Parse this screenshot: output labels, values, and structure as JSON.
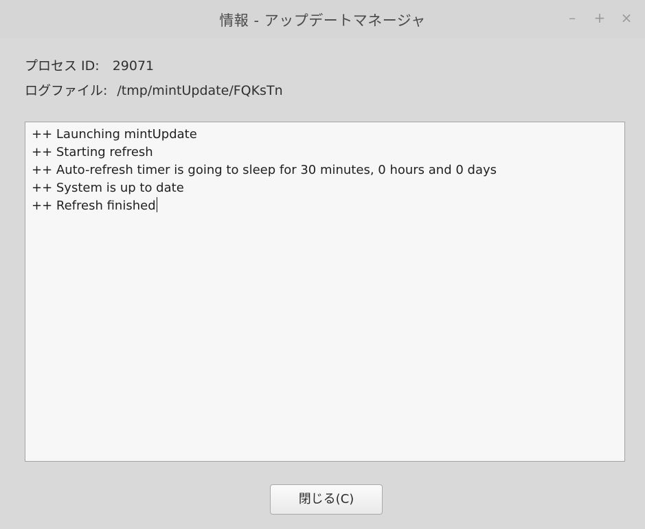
{
  "window": {
    "title": "情報 - アップデートマネージャ",
    "controls": {
      "minimize": "–",
      "maximize": "+",
      "close": "×"
    }
  },
  "info": {
    "process_id_label": "プロセス ID:",
    "process_id_value": "29071",
    "logfile_label": "ログファイル:",
    "logfile_value": "/tmp/mintUpdate/FQKsTn"
  },
  "log": {
    "lines": [
      "++ Launching mintUpdate",
      "++ Starting refresh",
      "++ Auto-refresh timer is going to sleep for 30 minutes, 0 hours and 0 days",
      "++ System is up to date",
      "++ Refresh finished"
    ]
  },
  "buttons": {
    "close_label": "閉じる(C)"
  }
}
